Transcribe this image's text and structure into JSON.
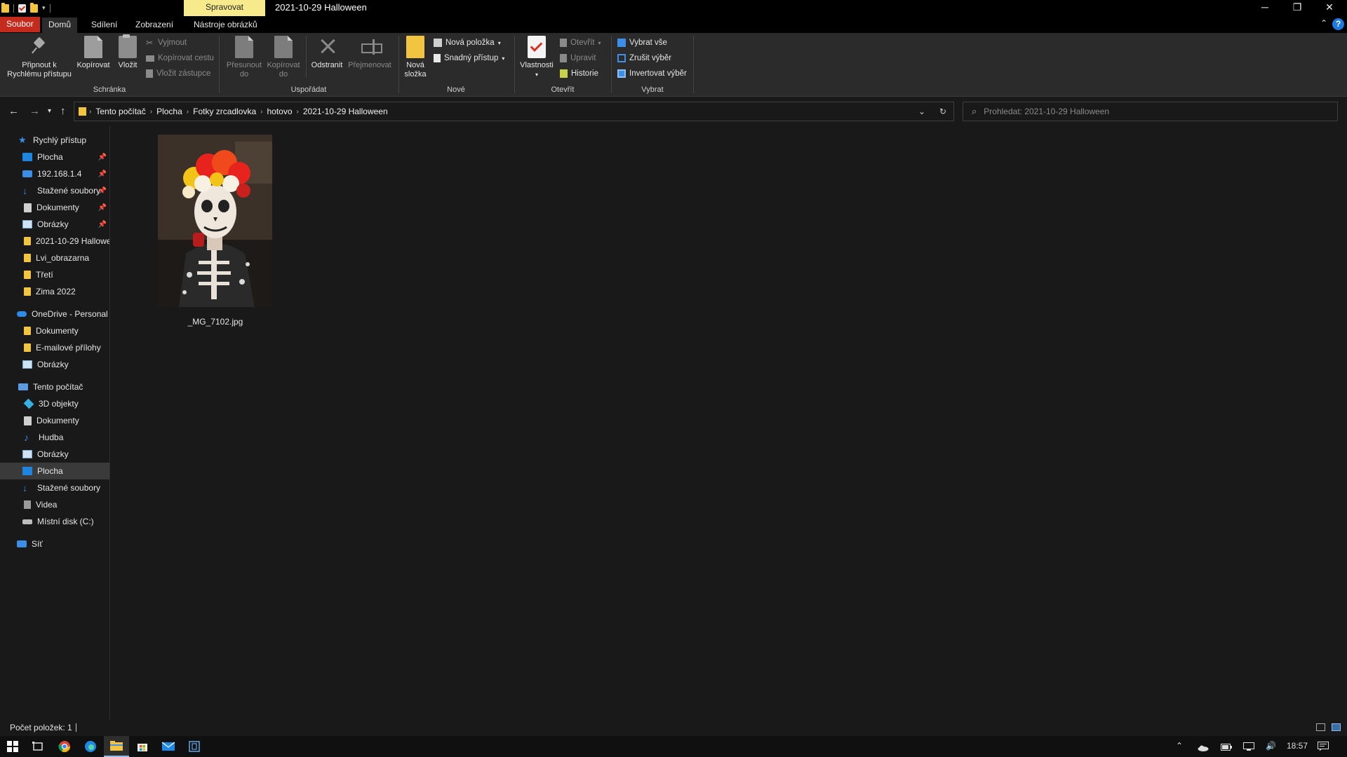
{
  "window": {
    "title": "2021-10-29 Halloween",
    "context_tab": "Spravovat",
    "controls": {
      "minimize": "─",
      "restore": "❐",
      "close": "✕"
    }
  },
  "ribbon": {
    "tabs": [
      "Soubor",
      "Domů",
      "Sdílení",
      "Zobrazení",
      "Nástroje obrázků"
    ],
    "help": "?",
    "clipboard": {
      "label": "Schránka",
      "pin": "Připnout k Rychlému přístupu",
      "copy": "Kopírovat",
      "paste": "Vložit",
      "cut": "Vyjmout",
      "copy_path": "Kopírovat cestu",
      "paste_shortcut": "Vložit zástupce"
    },
    "organize": {
      "label": "Uspořádat",
      "move_to": "Přesunout do",
      "copy_to": "Kopírovat do",
      "delete": "Odstranit",
      "rename": "Přejmenovat"
    },
    "new": {
      "label": "Nové",
      "new_folder": "Nová složka",
      "new_item": "Nová položka",
      "easy_access": "Snadný přístup"
    },
    "open": {
      "label": "Otevřít",
      "properties": "Vlastnosti",
      "open": "Otevřít",
      "edit": "Upravit",
      "history": "Historie"
    },
    "select": {
      "label": "Vybrat",
      "select_all": "Vybrat vše",
      "select_none": "Zrušit výběr",
      "invert": "Invertovat výběr"
    }
  },
  "address": {
    "breadcrumb": [
      "Tento počítač",
      "Plocha",
      "Fotky zrcadlovka",
      "hotovo",
      "2021-10-29 Halloween"
    ],
    "search_placeholder": "Prohledat: 2021-10-29 Halloween"
  },
  "sidebar": {
    "quick_access": {
      "label": "Rychlý přístup",
      "items": [
        "Plocha",
        "192.168.1.4",
        "Stažené soubory",
        "Dokumenty",
        "Obrázky",
        "2021-10-29 Hallowe",
        "Lvi_obrazarna",
        "Třetí",
        "Zima 2022"
      ]
    },
    "onedrive": {
      "label": "OneDrive - Personal",
      "items": [
        "Dokumenty",
        "E-mailové přílohy",
        "Obrázky"
      ]
    },
    "this_pc": {
      "label": "Tento počítač",
      "items": [
        "3D objekty",
        "Dokumenty",
        "Hudba",
        "Obrázky",
        "Plocha",
        "Stažené soubory",
        "Videa",
        "Místní disk (C:)"
      ]
    },
    "network": {
      "label": "Síť"
    }
  },
  "files": [
    {
      "name": "_MG_7102.jpg"
    }
  ],
  "status": {
    "item_count": "Počet položek: 1"
  },
  "taskbar": {
    "clock": "18:57"
  }
}
